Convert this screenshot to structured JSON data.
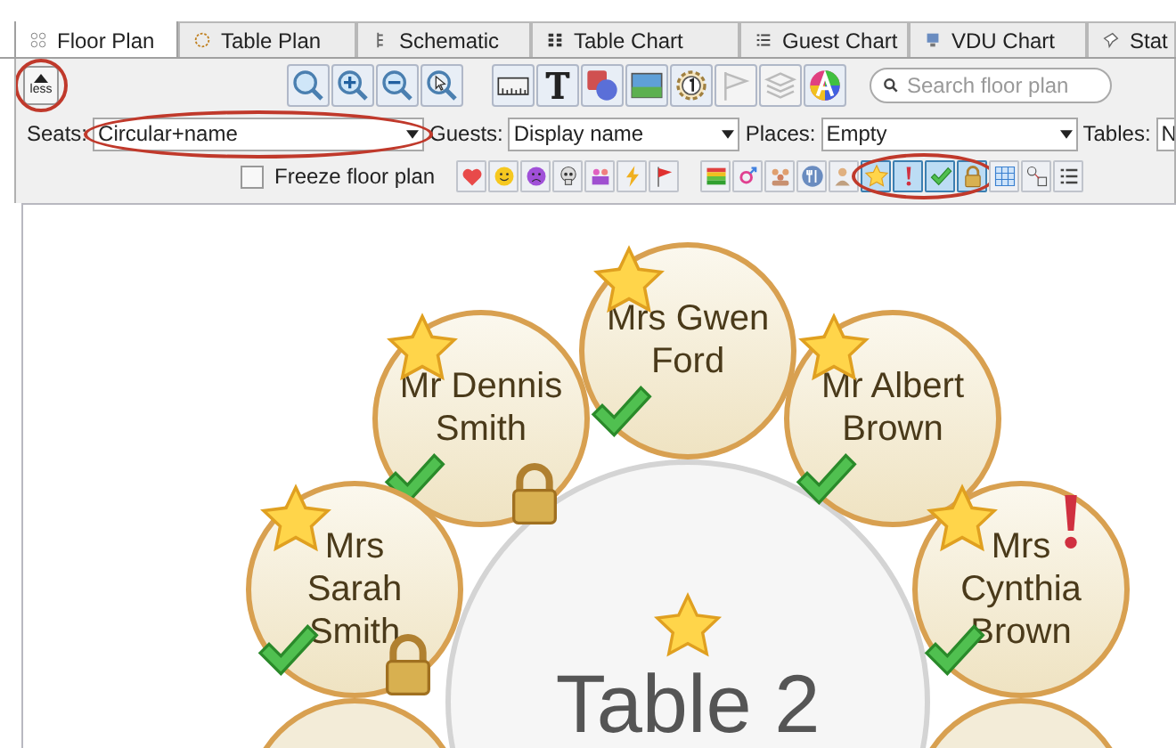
{
  "tabs": [
    {
      "label": "Floor Plan",
      "selected": true
    },
    {
      "label": "Table Plan",
      "selected": false
    },
    {
      "label": "Schematic",
      "selected": false
    },
    {
      "label": "Table Chart",
      "selected": false
    },
    {
      "label": "Guest Chart",
      "selected": false
    },
    {
      "label": "VDU Chart",
      "selected": false
    },
    {
      "label": "Stat",
      "selected": false
    }
  ],
  "less_button": {
    "label": "less",
    "highlighted": true
  },
  "toolbar_groups": [
    {
      "buttons": [
        {
          "kind": "zoom",
          "disabled": false
        },
        {
          "kind": "zoom-in",
          "disabled": false
        },
        {
          "kind": "zoom-out",
          "disabled": false
        },
        {
          "kind": "zoom-select",
          "disabled": false
        }
      ]
    },
    {
      "buttons": [
        {
          "kind": "ruler",
          "disabled": false
        },
        {
          "kind": "text",
          "disabled": false
        },
        {
          "kind": "shapes",
          "disabled": false
        },
        {
          "kind": "image",
          "disabled": false
        },
        {
          "kind": "numbered-table",
          "disabled": false
        },
        {
          "kind": "flag",
          "disabled": true
        },
        {
          "kind": "layers",
          "disabled": true
        },
        {
          "kind": "color-wheel",
          "disabled": false
        }
      ]
    }
  ],
  "search": {
    "placeholder": "Search floor plan"
  },
  "dropdowns": [
    {
      "label": "Seats:",
      "value": "Circular+name",
      "highlighted": true
    },
    {
      "label": "Guests:",
      "value": "Display name",
      "highlighted": false
    },
    {
      "label": "Places:",
      "value": "Empty",
      "highlighted": false
    },
    {
      "label": "Tables:",
      "value": "N",
      "highlighted": false
    }
  ],
  "freeze": {
    "label": "Freeze floor plan",
    "checked": false
  },
  "marker_groups": [
    {
      "highlighted": false,
      "buttons": [
        {
          "kind": "heart",
          "pressed": false
        },
        {
          "kind": "smile",
          "pressed": false
        },
        {
          "kind": "sad",
          "pressed": false
        },
        {
          "kind": "skull",
          "pressed": false
        },
        {
          "kind": "people",
          "pressed": false
        },
        {
          "kind": "lightning",
          "pressed": false
        },
        {
          "kind": "red-flag",
          "pressed": false
        }
      ]
    },
    {
      "highlighted": false,
      "buttons": [
        {
          "kind": "gradient",
          "pressed": false
        },
        {
          "kind": "gender",
          "pressed": false
        },
        {
          "kind": "group",
          "pressed": false
        },
        {
          "kind": "cutlery",
          "pressed": false
        },
        {
          "kind": "person",
          "pressed": false
        }
      ]
    },
    {
      "highlighted": true,
      "buttons": [
        {
          "kind": "star",
          "pressed": true
        },
        {
          "kind": "exclaim",
          "pressed": true
        },
        {
          "kind": "check",
          "pressed": true
        },
        {
          "kind": "lock",
          "pressed": true
        }
      ]
    },
    {
      "highlighted": false,
      "buttons": [
        {
          "kind": "grid",
          "pressed": false
        },
        {
          "kind": "diagram",
          "pressed": false
        },
        {
          "kind": "list",
          "pressed": false
        }
      ]
    }
  ],
  "table": {
    "label": "Table 2",
    "star": true
  },
  "seats": [
    {
      "name": "Mr Dennis\nSmith",
      "star": true,
      "check": true,
      "lock": true,
      "exclaim": false
    },
    {
      "name": "Mrs Gwen\nFord",
      "star": true,
      "check": true,
      "lock": false,
      "exclaim": false
    },
    {
      "name": "Mr Albert\nBrown",
      "star": true,
      "check": true,
      "lock": false,
      "exclaim": false
    },
    {
      "name": "Mrs\nSarah\nSmith",
      "star": true,
      "check": true,
      "lock": true,
      "exclaim": false
    },
    {
      "name": "Mrs\nCynthia\nBrown",
      "star": true,
      "check": true,
      "lock": false,
      "exclaim": true
    }
  ]
}
